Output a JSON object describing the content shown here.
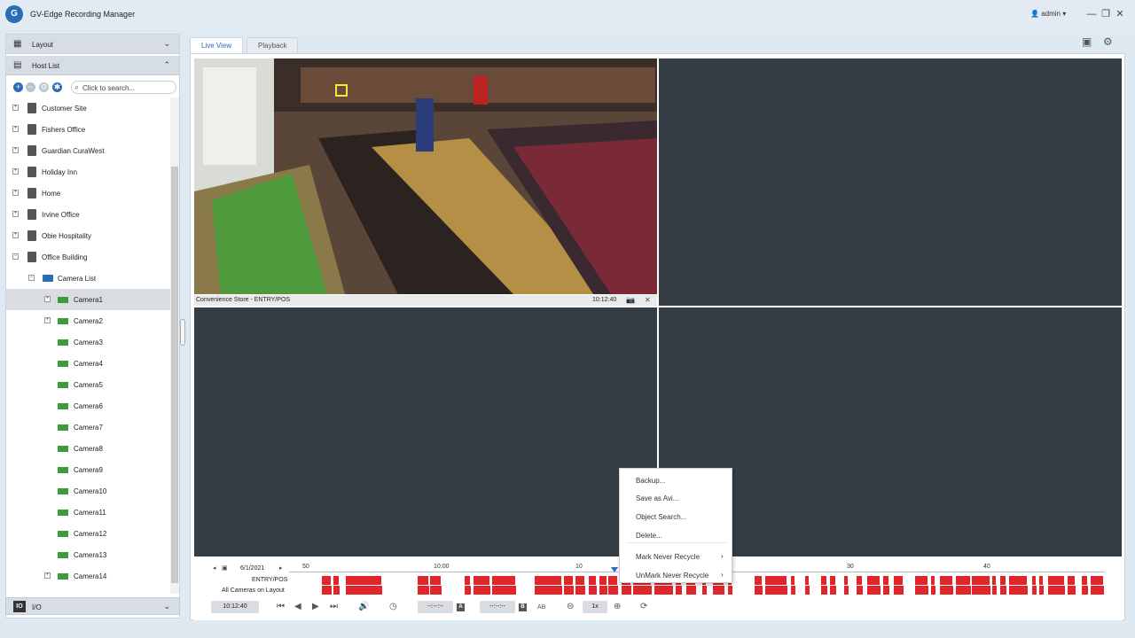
{
  "window": {
    "title": "GV-Edge Recording Manager",
    "user": "admin",
    "logo_icon": "gv-logo-icon"
  },
  "sidebar": {
    "layout_label": "Layout",
    "host_list_label": "Host List",
    "search_placeholder": "Click to search...",
    "io_label": "I/O",
    "io_icon_text": "IO",
    "tree": [
      {
        "label": "Customer Site",
        "type": "host"
      },
      {
        "label": "Fishers Office",
        "type": "host"
      },
      {
        "label": "Guardian CuraWest",
        "type": "host"
      },
      {
        "label": "Holiday Inn",
        "type": "host"
      },
      {
        "label": "Home",
        "type": "host"
      },
      {
        "label": "Irvine Office",
        "type": "host"
      },
      {
        "label": "Obie Hospitality",
        "type": "host"
      },
      {
        "label": "Office Building",
        "type": "host"
      },
      {
        "label": "Camera List",
        "type": "group"
      },
      {
        "label": "Camera1",
        "type": "camera"
      },
      {
        "label": "Camera2",
        "type": "camera"
      },
      {
        "label": "Camera3",
        "type": "camera"
      },
      {
        "label": "Camera4",
        "type": "camera"
      },
      {
        "label": "Camera5",
        "type": "camera"
      },
      {
        "label": "Camera6",
        "type": "camera"
      },
      {
        "label": "Camera7",
        "type": "camera"
      },
      {
        "label": "Camera8",
        "type": "camera"
      },
      {
        "label": "Camera9",
        "type": "camera"
      },
      {
        "label": "Camera10",
        "type": "camera"
      },
      {
        "label": "Camera11",
        "type": "camera"
      },
      {
        "label": "Camera12",
        "type": "camera"
      },
      {
        "label": "Camera13",
        "type": "camera"
      },
      {
        "label": "Camera14",
        "type": "camera"
      }
    ]
  },
  "tabs": {
    "live_view": "Live View",
    "playback": "Playback"
  },
  "feed": {
    "camera_name": "Convenience Store - ENTRY/POS",
    "time": "10:12:40"
  },
  "timeline": {
    "date": "6/1/2021",
    "ticks": [
      "50",
      "10:00",
      "10",
      "30",
      "40"
    ],
    "row1_label": "ENTRY/POS",
    "row2_label": "All Cameras on Layout",
    "current_time": "10:12:40",
    "range_a": "--:--:--",
    "range_b": "--:--:--",
    "speed": "1x",
    "a_label": "A",
    "b_label": "B",
    "ab_label": "AB"
  },
  "context_menu": {
    "backup": "Backup...",
    "save_avi": "Save as Avi...",
    "object_search": "Object Search...",
    "delete": "Delete...",
    "mark_never_recycle": "Mark Never Recycle",
    "unmark_never_recycle": "UnMark Never Recycle"
  },
  "colors": {
    "accent": "#2b6cb8",
    "recording": "#e0262a",
    "empty_cell": "#343c44",
    "camera_icon": "#3e9a3e"
  }
}
